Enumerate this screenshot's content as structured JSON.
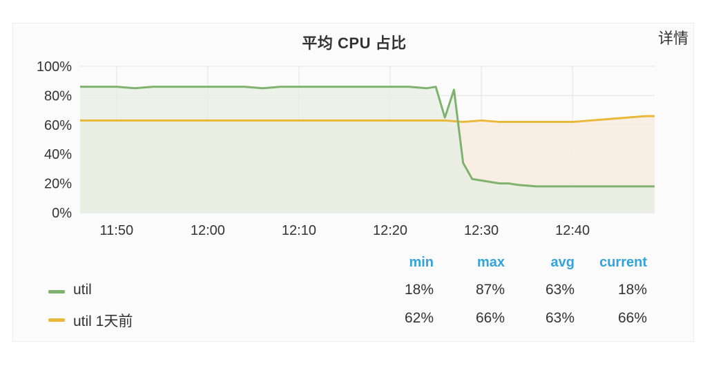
{
  "panel": {
    "title": "平均 CPU 占比",
    "detail_label": "详情"
  },
  "legend": {
    "headers": [
      "min",
      "max",
      "avg",
      "current"
    ],
    "header_color": "#33a3dc",
    "rows": [
      {
        "name": "util",
        "color": "#7eb26d",
        "min": "18%",
        "max": "87%",
        "avg": "63%",
        "current": "18%"
      },
      {
        "name": "util 1天前",
        "color": "#eab839",
        "min": "62%",
        "max": "66%",
        "avg": "63%",
        "current": "66%"
      }
    ]
  },
  "chart_data": {
    "type": "area",
    "title": "平均 CPU 占比",
    "x_tick_labels": [
      "11:50",
      "12:00",
      "12:10",
      "12:20",
      "12:30",
      "12:40"
    ],
    "y_tick_labels": [
      "0%",
      "20%",
      "40%",
      "60%",
      "80%",
      "100%"
    ],
    "ylim": [
      0,
      100
    ],
    "xlim": [
      "11:46",
      "12:49"
    ],
    "grid": true,
    "legend_position": "bottom",
    "series": [
      {
        "name": "util",
        "color": "#7eb26d",
        "fill": "#e7efe3",
        "x": [
          "11:46",
          "11:48",
          "11:50",
          "11:52",
          "11:54",
          "11:56",
          "11:58",
          "12:00",
          "12:02",
          "12:04",
          "12:06",
          "12:08",
          "12:10",
          "12:12",
          "12:14",
          "12:16",
          "12:18",
          "12:20",
          "12:22",
          "12:24",
          "12:25",
          "12:26",
          "12:27",
          "12:28",
          "12:29",
          "12:30",
          "12:31",
          "12:32",
          "12:33",
          "12:34",
          "12:36",
          "12:38",
          "12:40",
          "12:42",
          "12:44",
          "12:46",
          "12:48",
          "12:49"
        ],
        "values": [
          86,
          86,
          86,
          85,
          86,
          86,
          86,
          86,
          86,
          86,
          85,
          86,
          86,
          86,
          86,
          86,
          86,
          86,
          86,
          85,
          86,
          65,
          84,
          34,
          23,
          22,
          21,
          20,
          20,
          19,
          18,
          18,
          18,
          18,
          18,
          18,
          18,
          18
        ]
      },
      {
        "name": "util 1天前",
        "color": "#eab839",
        "fill": "#f7ece1",
        "x": [
          "11:46",
          "11:48",
          "11:50",
          "11:52",
          "11:54",
          "11:56",
          "11:58",
          "12:00",
          "12:02",
          "12:04",
          "12:06",
          "12:08",
          "12:10",
          "12:12",
          "12:14",
          "12:16",
          "12:18",
          "12:20",
          "12:22",
          "12:24",
          "12:26",
          "12:28",
          "12:30",
          "12:32",
          "12:34",
          "12:36",
          "12:38",
          "12:40",
          "12:42",
          "12:44",
          "12:46",
          "12:48",
          "12:49"
        ],
        "values": [
          63,
          63,
          63,
          63,
          63,
          63,
          63,
          63,
          63,
          63,
          63,
          63,
          63,
          63,
          63,
          63,
          63,
          63,
          63,
          63,
          63,
          62,
          63,
          62,
          62,
          62,
          62,
          62,
          63,
          64,
          65,
          66,
          66
        ]
      }
    ]
  }
}
